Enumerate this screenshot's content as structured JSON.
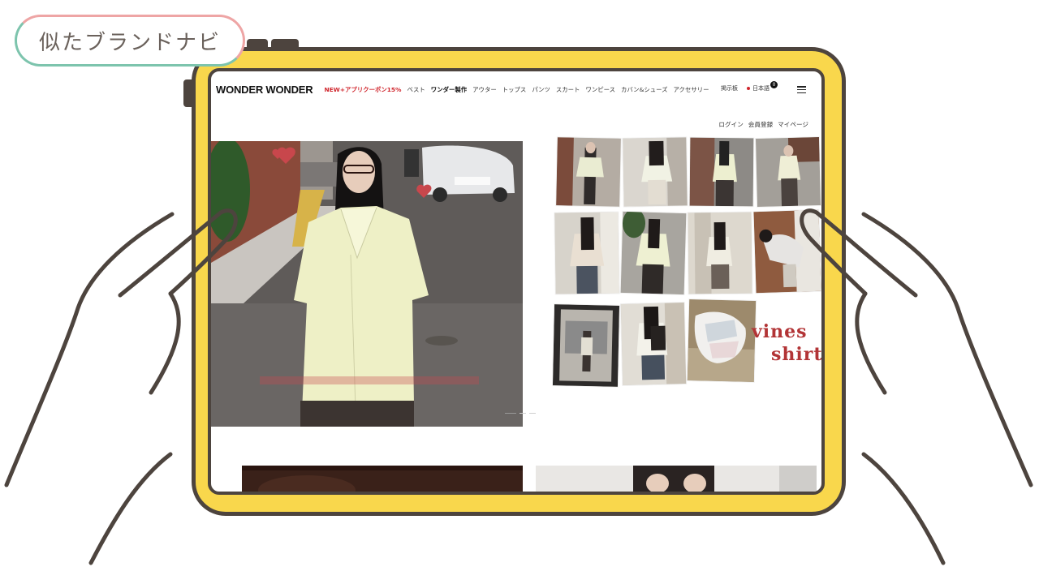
{
  "badge": {
    "label": "似たブランドナビ"
  },
  "site": {
    "logo": "WONDER WONDER",
    "nav": [
      {
        "label": "NEW+アプリクーポン15%",
        "style": "promo"
      },
      {
        "label": "ベスト",
        "style": "normal"
      },
      {
        "label": "ワンダー製作",
        "style": "bold"
      },
      {
        "label": "アウター",
        "style": "normal"
      },
      {
        "label": "トップス",
        "style": "normal"
      },
      {
        "label": "パンツ",
        "style": "normal"
      },
      {
        "label": "スカート",
        "style": "normal"
      },
      {
        "label": "ワンピース",
        "style": "normal"
      },
      {
        "label": "カバン&シューズ",
        "style": "normal"
      },
      {
        "label": "アクセサリー",
        "style": "normal"
      }
    ],
    "board_label": "掲示板",
    "language_label": "日本語",
    "cart_count": "0",
    "account": {
      "login": "ログイン",
      "register": "会員登録",
      "mypage": "マイページ"
    },
    "collage_text": {
      "line1": "vines",
      "line2": "shirt"
    }
  },
  "colors": {
    "frame": "#f9d74c",
    "outline": "#4d443e",
    "promo": "#d0262d",
    "badge_green": "#7dc4ad",
    "badge_pink": "#eea5a5"
  },
  "icons": {
    "menu": "hamburger-menu-icon",
    "cart": "cart-count-badge",
    "language": "language-dot-icon"
  }
}
